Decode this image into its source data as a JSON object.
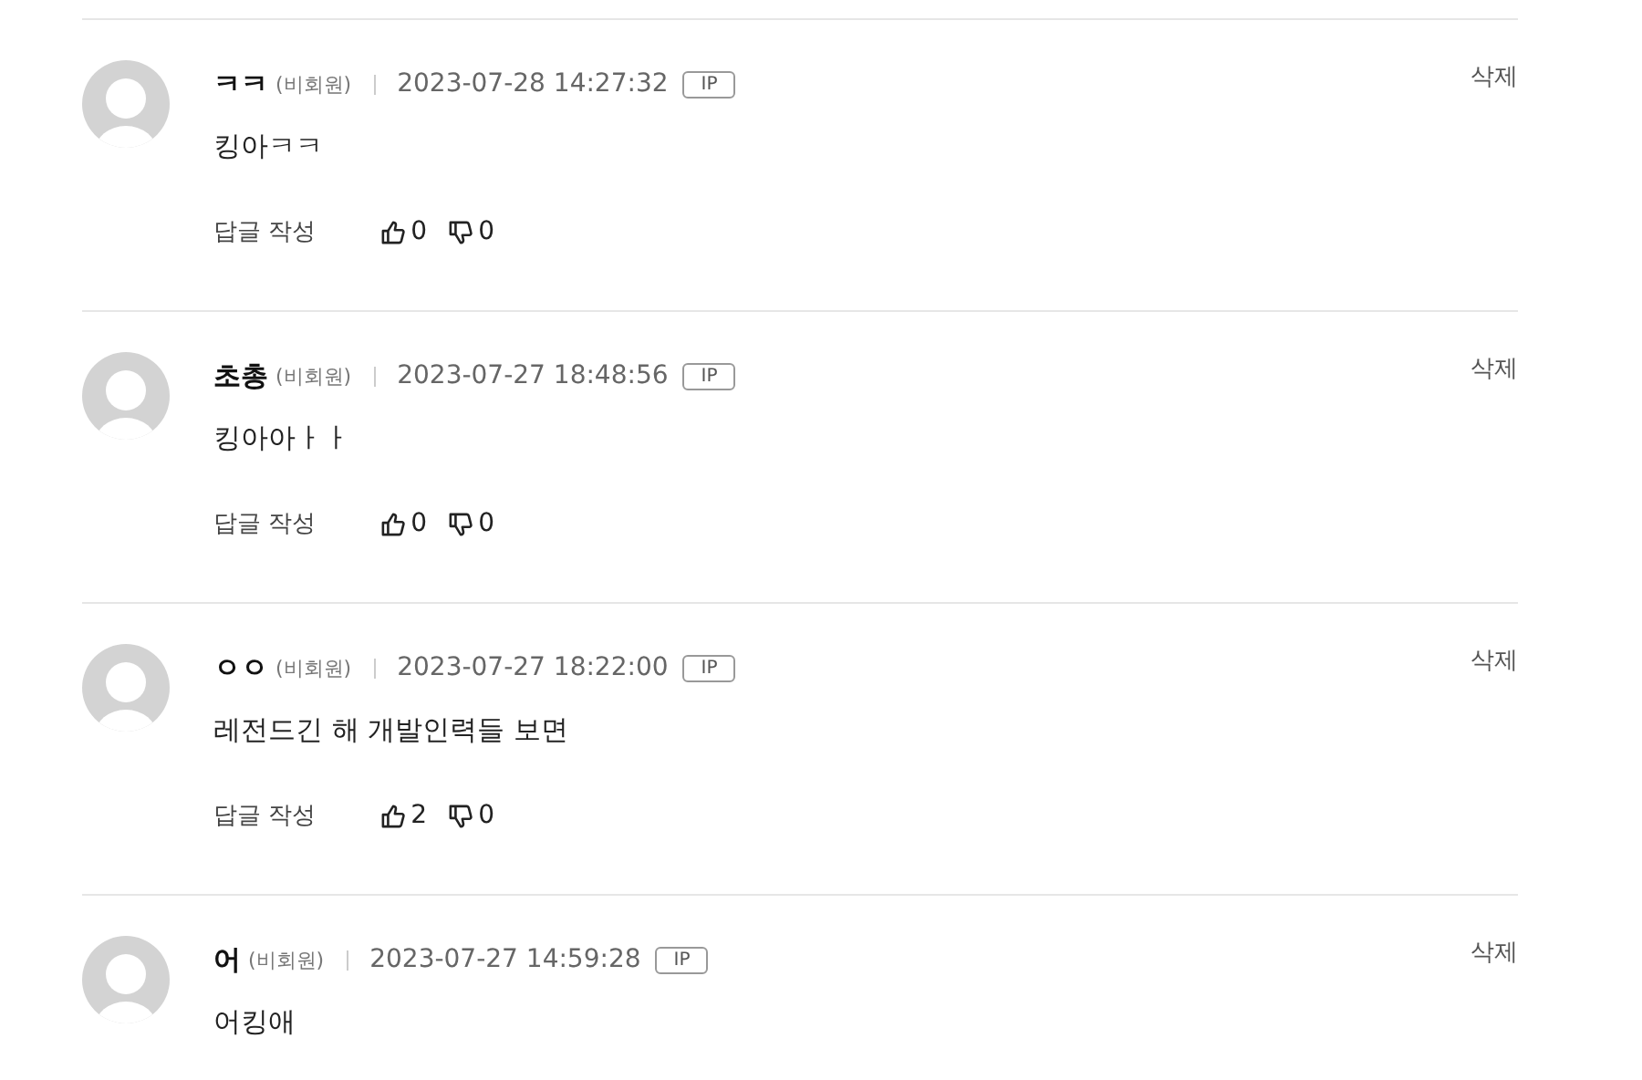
{
  "comments": [
    {
      "author": "ㅋㅋ",
      "member_tag": "(비회원)",
      "time": "2023-07-28 14:27:32",
      "ip_badge": "IP",
      "delete": "삭제",
      "text": "킹아ㅋㅋ",
      "reply": "답글 작성",
      "likes": "0",
      "dislikes": "0"
    },
    {
      "author": "초총",
      "member_tag": "(비회원)",
      "time": "2023-07-27 18:48:56",
      "ip_badge": "IP",
      "delete": "삭제",
      "text": "킹아아ㅏㅏ",
      "reply": "답글 작성",
      "likes": "0",
      "dislikes": "0"
    },
    {
      "author": "ㅇㅇ",
      "member_tag": "(비회원)",
      "time": "2023-07-27 18:22:00",
      "ip_badge": "IP",
      "delete": "삭제",
      "text": "레전드긴 해 개발인력들 보면",
      "reply": "답글 작성",
      "likes": "2",
      "dislikes": "0"
    },
    {
      "author": "어",
      "member_tag": "(비회원)",
      "time": "2023-07-27 14:59:28",
      "ip_badge": "IP",
      "delete": "삭제",
      "text": "어킹애"
    }
  ]
}
